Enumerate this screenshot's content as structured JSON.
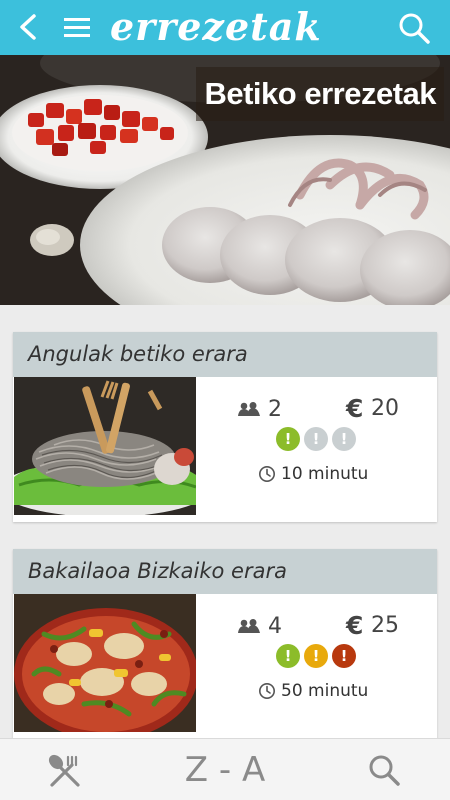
{
  "app": {
    "title": "errezetak"
  },
  "hero": {
    "title": "Betiko errezetak"
  },
  "recipes": [
    {
      "title": "Angulak betiko erara",
      "people": "2",
      "price": "20",
      "currency": "€",
      "difficulty": [
        "green",
        "grey",
        "grey"
      ],
      "time": "10 minutu"
    },
    {
      "title": "Bakailaoa Bizkaiko erara",
      "people": "4",
      "price": "25",
      "currency": "€",
      "difficulty": [
        "green",
        "yellow",
        "red"
      ],
      "time": "50 minutu"
    }
  ],
  "colors": {
    "accent": "#3cc0dc",
    "card_head": "#c7d1d3",
    "green": "#8cbc2a",
    "yellow": "#e8a90c",
    "red": "#b8390e",
    "grey": "#c9cfd1"
  },
  "bottom_nav": {
    "recipes_icon": "fork-spoon-icon",
    "az_label": "Z - A",
    "search_icon": "search-icon"
  }
}
